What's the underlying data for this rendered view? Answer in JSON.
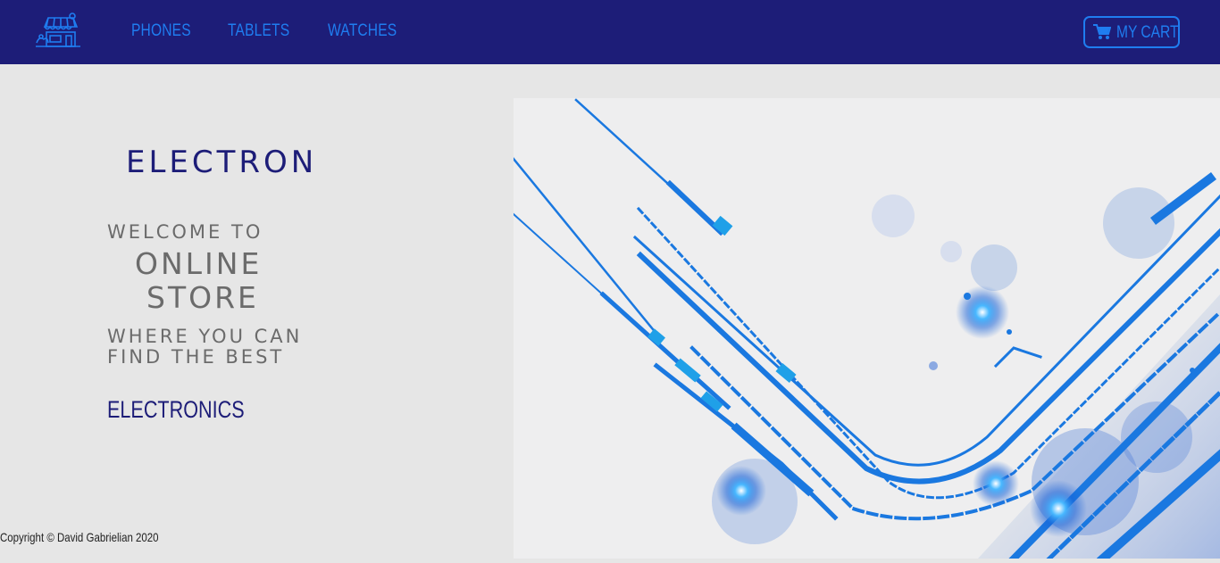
{
  "nav": {
    "logo_icon": "storefront-icon",
    "links": [
      "PHONES",
      "TABLETS",
      "WATCHES"
    ],
    "cart_label": "MY CART",
    "cart_icon": "shopping-cart-icon"
  },
  "hero": {
    "brand": "ELECTRON",
    "welcome": "WELCOME TO",
    "online": "ONLINE",
    "store": "STORE",
    "where": "WHERE YOU CAN FIND THE BEST",
    "electronics": "ELECTRONICS",
    "image_icon": "circuit-tech-illustration"
  },
  "footer": {
    "copyright": "Copyright © David Gabrielian 2020"
  },
  "colors": {
    "navbar": "#1d1d78",
    "accent": "#1f7df0",
    "background": "#e6e6e6",
    "text_gray": "#6b6b6b"
  }
}
